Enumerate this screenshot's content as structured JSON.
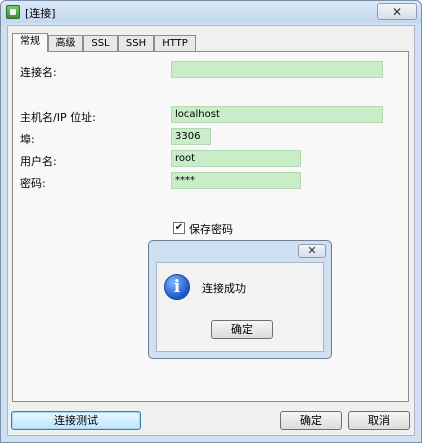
{
  "window": {
    "title": "[连接]",
    "close_glyph": "✕",
    "icon": "navicat-icon"
  },
  "tabs": [
    {
      "label": "常规",
      "active": true
    },
    {
      "label": "高级",
      "active": false
    },
    {
      "label": "SSL",
      "active": false
    },
    {
      "label": "SSH",
      "active": false
    },
    {
      "label": "HTTP",
      "active": false
    }
  ],
  "form": {
    "connection_name": {
      "label": "连接名:",
      "value": ""
    },
    "host": {
      "label": "主机名/IP 位址:",
      "value": "localhost"
    },
    "port": {
      "label": "埠:",
      "value": "3306"
    },
    "username": {
      "label": "用户名:",
      "value": "root"
    },
    "password": {
      "label": "密码:",
      "value": "****"
    },
    "save_password": {
      "label": "保存密码",
      "checked": true,
      "glyph": "✔"
    }
  },
  "buttons": {
    "test": "连接测试",
    "ok": "确定",
    "cancel": "取消"
  },
  "message_box": {
    "text": "连接成功",
    "ok": "确定",
    "close_glyph": "✕",
    "icon_glyph": "i",
    "icon": "info-icon"
  },
  "colors": {
    "field_bg": "#c9ecc9",
    "window_frame": "#cfe0f2"
  }
}
